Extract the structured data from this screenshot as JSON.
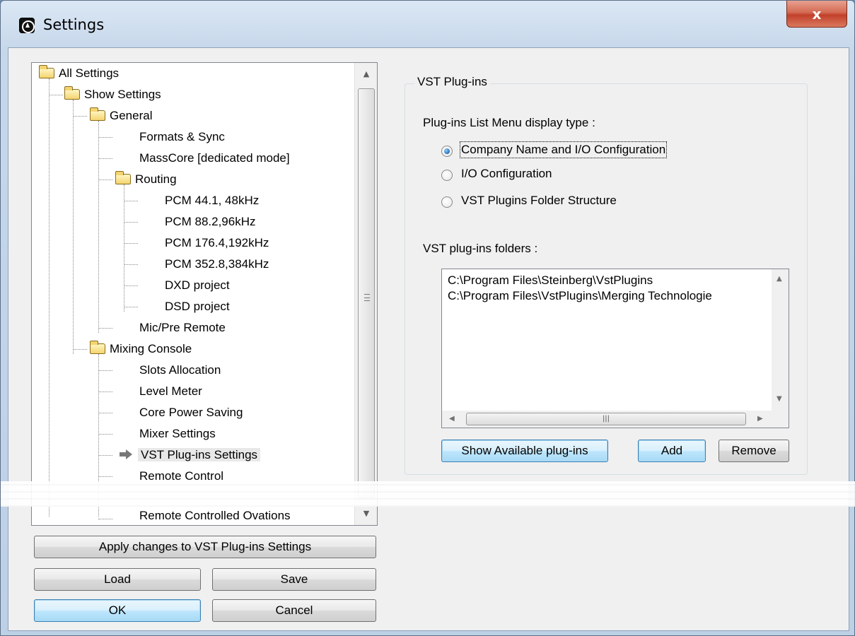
{
  "window": {
    "title": "Settings",
    "icon": "app-logo-icon",
    "close_label": "x"
  },
  "tree": {
    "items": [
      {
        "label": "All Settings",
        "icon": "folder-icon"
      },
      {
        "label": "Show Settings",
        "icon": "folder-icon"
      },
      {
        "label": "General",
        "icon": "folder-icon"
      },
      {
        "label": "Formats & Sync"
      },
      {
        "label": "MassCore [dedicated mode]"
      },
      {
        "label": "Routing",
        "icon": "folder-icon"
      },
      {
        "label": "PCM 44.1, 48kHz"
      },
      {
        "label": "PCM 88.2,96kHz"
      },
      {
        "label": "PCM 176.4,192kHz"
      },
      {
        "label": "PCM 352.8,384kHz"
      },
      {
        "label": "DXD project"
      },
      {
        "label": "DSD project"
      },
      {
        "label": "Mic/Pre Remote"
      },
      {
        "label": "Mixing Console",
        "icon": "folder-icon"
      },
      {
        "label": "Slots Allocation"
      },
      {
        "label": "Level Meter"
      },
      {
        "label": "Core Power Saving"
      },
      {
        "label": "Mixer Settings"
      },
      {
        "label": "VST Plug-ins Settings",
        "icon": "arrow-right-icon",
        "selected": true
      },
      {
        "label": "Remote Control"
      },
      {
        "label": "Remote Controlled Ovations"
      }
    ]
  },
  "buttons": {
    "apply": "Apply changes to VST Plug-ins Settings",
    "load": "Load",
    "save": "Save",
    "ok": "OK",
    "cancel": "Cancel"
  },
  "vst": {
    "group_title": "VST Plug-ins",
    "display_type_label": "Plug-ins List Menu display type :",
    "options": [
      {
        "label": "Company Name and I/O Configuration",
        "checked": true
      },
      {
        "label": "I/O Configuration",
        "checked": false
      },
      {
        "label": "VST Plugins Folder Structure",
        "checked": false
      }
    ],
    "folders_label": "VST plug-ins folders :",
    "folders": [
      "C:\\Program Files\\Steinberg\\VstPlugins",
      "C:\\Program Files\\VstPlugins\\Merging Technologie"
    ],
    "show_available_label": "Show Available plug-ins",
    "add_label": "Add",
    "remove_label": "Remove"
  }
}
